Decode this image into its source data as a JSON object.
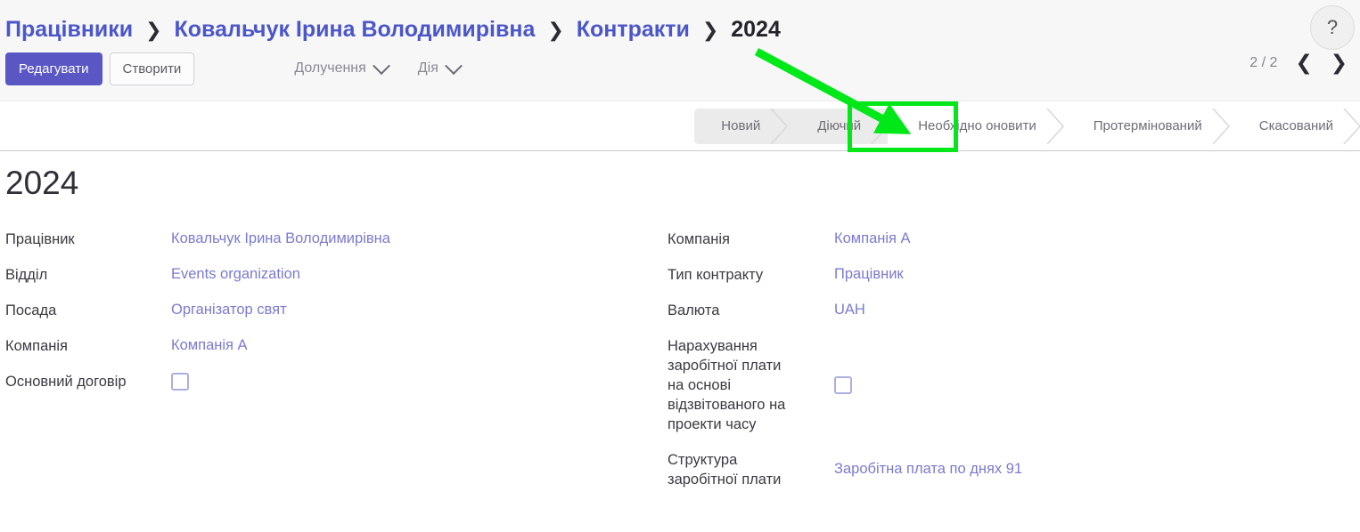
{
  "breadcrumb": {
    "items": [
      {
        "label": "Працівники",
        "current": false
      },
      {
        "label": "Ковальчук Ірина Володимирівна",
        "current": false
      },
      {
        "label": "Контракти",
        "current": false
      },
      {
        "label": "2024",
        "current": true
      }
    ],
    "separator": "❯"
  },
  "help": {
    "icon": "question-mark-icon",
    "label": "?"
  },
  "toolbar": {
    "edit_label": "Редагувати",
    "create_label": "Створити",
    "menus": [
      {
        "label": "Долучення",
        "icon": "chevron-down-icon"
      },
      {
        "label": "Дія",
        "icon": "chevron-down-icon"
      }
    ],
    "pager": {
      "count": "2 / 2",
      "prev_icon": "chevron-left-icon",
      "prev_label": "❮",
      "next_icon": "chevron-right-icon",
      "next_label": "❯"
    }
  },
  "statusbar": {
    "steps": [
      {
        "label": "Новий",
        "active": false
      },
      {
        "label": "Діючий",
        "active": true
      },
      {
        "label": "Необхідно оновити",
        "active": false
      },
      {
        "label": "Протермінований",
        "active": false
      },
      {
        "label": "Скасований",
        "active": false
      }
    ]
  },
  "annotation": {
    "highlight_color": "#00e818",
    "arrow_color": "#00e818",
    "target_step": "Діючий"
  },
  "record": {
    "title": "2024",
    "left_fields": [
      {
        "label": "Працівник",
        "value": "Ковальчук Ірина Володимирівна",
        "type": "link"
      },
      {
        "label": "Відділ",
        "value": "Events organization",
        "type": "link"
      },
      {
        "label": "Посада",
        "value": "Організатор свят",
        "type": "link"
      },
      {
        "label": "Компанія",
        "value": "Компанія А",
        "type": "link"
      },
      {
        "label": "Основний договір",
        "value": "",
        "type": "checkbox",
        "checked": false
      }
    ],
    "right_fields": [
      {
        "label": "Компанія",
        "value": "Компанія А",
        "type": "link"
      },
      {
        "label": "Тип контракту",
        "value": "Працівник",
        "type": "link"
      },
      {
        "label": "Валюта",
        "value": "UAH",
        "type": "link"
      },
      {
        "label": "Нарахування\nзаробітної плати\nна основі\nвідзвітованого на\nпроекти часу",
        "value": "",
        "type": "checkbox",
        "checked": false
      },
      {
        "label": "Структура\nзаробітної плати",
        "value": "Заробітна плата по днях 91",
        "type": "link"
      }
    ]
  },
  "colors": {
    "accent_link": "#7b7ad0",
    "breadcrumb_link": "#4b56c8",
    "primary_button": "#5a57c4",
    "header_band": "#f7f7f8",
    "status_filled": "#ebebeb",
    "annotation_green": "#00e818"
  }
}
